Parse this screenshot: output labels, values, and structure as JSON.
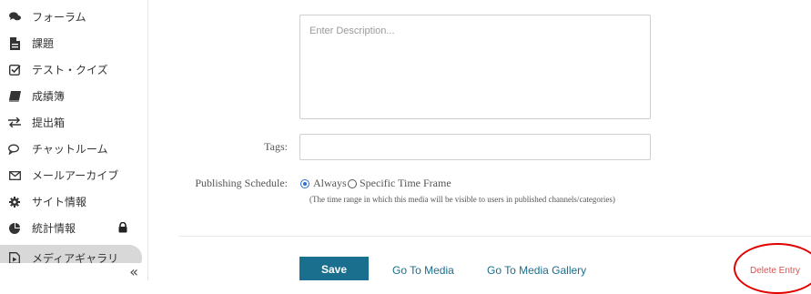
{
  "sidebar": {
    "items": [
      {
        "label": "フォーラム",
        "icon": "comments-icon"
      },
      {
        "label": "課題",
        "icon": "file-icon"
      },
      {
        "label": "テスト・クイズ",
        "icon": "checkbox-icon"
      },
      {
        "label": "成績簿",
        "icon": "book-icon"
      },
      {
        "label": "提出箱",
        "icon": "exchange-icon"
      },
      {
        "label": "チャットルーム",
        "icon": "chat-icon"
      },
      {
        "label": "メールアーカイブ",
        "icon": "envelope-icon"
      },
      {
        "label": "サイト情報",
        "icon": "gear-icon"
      },
      {
        "label": "統計情報",
        "icon": "pie-chart-icon",
        "locked": true
      },
      {
        "label": "メディアギャラリ",
        "icon": "media-icon",
        "active": true
      }
    ],
    "collapse_label": "«"
  },
  "form": {
    "description_placeholder": "Enter Description...",
    "tags_label": "Tags:",
    "tags_value": "",
    "publishing_label": "Publishing Schedule:",
    "option_always": "Always",
    "option_specific": "Specific Time Frame",
    "selected_option": "Always",
    "hint": "(The time range in which this media will be visible to users in published channels/categories)"
  },
  "actions": {
    "save": "Save",
    "go_to_media": "Go To Media",
    "go_to_gallery": "Go To Media Gallery",
    "delete": "Delete Entry"
  },
  "colors": {
    "primary": "#1a6f8e",
    "delete": "#d9534f",
    "annotation_circle": "#e10000",
    "radio_selected": "#2b6cd6"
  }
}
